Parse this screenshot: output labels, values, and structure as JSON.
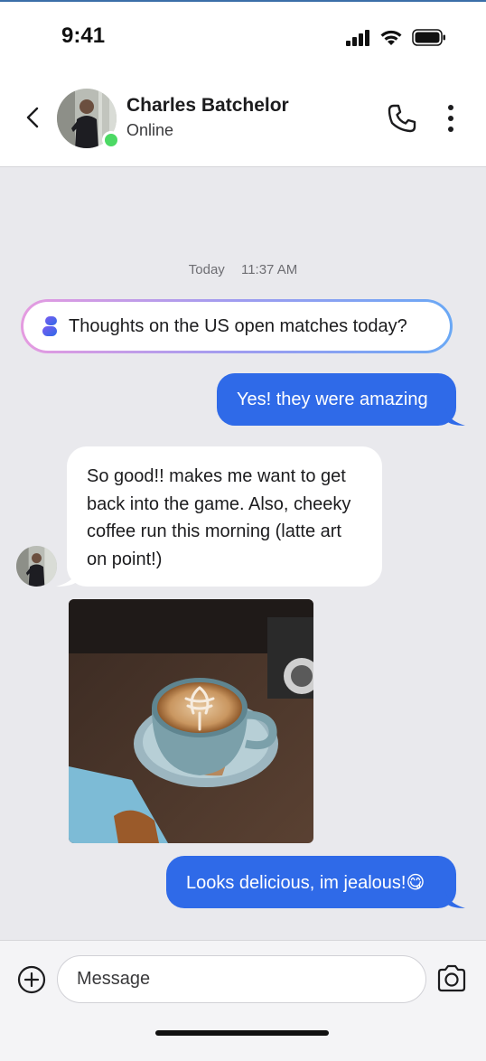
{
  "status_bar": {
    "time": "9:41",
    "icons": [
      "cellular-signal-icon",
      "wifi-icon",
      "battery-icon"
    ]
  },
  "header": {
    "back_icon": "chevron-left-icon",
    "contact_name": "Charles Batchelor",
    "contact_status": "Online",
    "actions": [
      "phone-icon",
      "more-vertical-icon"
    ]
  },
  "chat": {
    "date_label": "Today",
    "time_label": "11:37 AM",
    "ai_prompt": {
      "icon": "ai-sparkle-icon",
      "text": "Thoughts on the US open matches today?"
    },
    "messages": [
      {
        "direction": "outgoing",
        "text": "Yes! they were amazing"
      },
      {
        "direction": "incoming",
        "text": "So good!! makes me want to get back into the game. Also, cheeky coffee run this morning (latte art on point!)"
      },
      {
        "direction": "incoming",
        "type": "image",
        "content": "latte-art-photo"
      },
      {
        "direction": "outgoing",
        "text": "Looks delicious, im jealous!😋"
      }
    ]
  },
  "composer": {
    "placeholder": "Message",
    "icons": [
      "plus-circle-icon",
      "camera-icon"
    ]
  },
  "colors": {
    "outgoing_bubble": "#2f6ae8",
    "online_indicator": "#4cd964",
    "background": "#e9e9ed"
  }
}
